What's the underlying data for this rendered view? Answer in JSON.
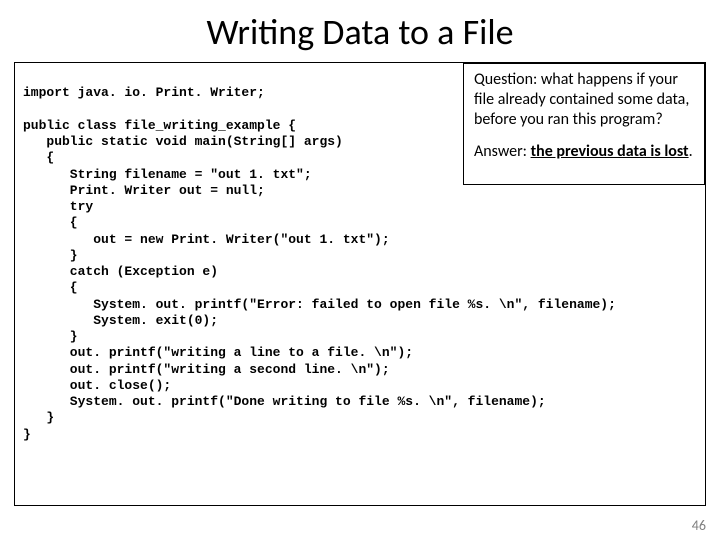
{
  "title": "Writing Data to a File",
  "code": "import java. io. Print. Writer;\n\npublic class file_writing_example {\n   public static void main(String[] args)\n   {\n      String filename = \"out 1. txt\";\n      Print. Writer out = null;\n      try\n      {\n         out = new Print. Writer(\"out 1. txt\");\n      }\n      catch (Exception e)\n      {\n         System. out. printf(\"Error: failed to open file %s. \\n\", filename);\n         System. exit(0);\n      }\n      out. printf(\"writing a line to a file. \\n\");\n      out. printf(\"writing a second line. \\n\");\n      out. close();\n      System. out. printf(\"Done writing to file %s. \\n\", filename);\n   }\n}",
  "qa": {
    "question": "Question: what happens if your file already contained some data, before you ran this program?",
    "answer_label": "Answer: ",
    "answer_text": "the previous data is lost",
    "answer_period": "."
  },
  "slide_number": "46"
}
